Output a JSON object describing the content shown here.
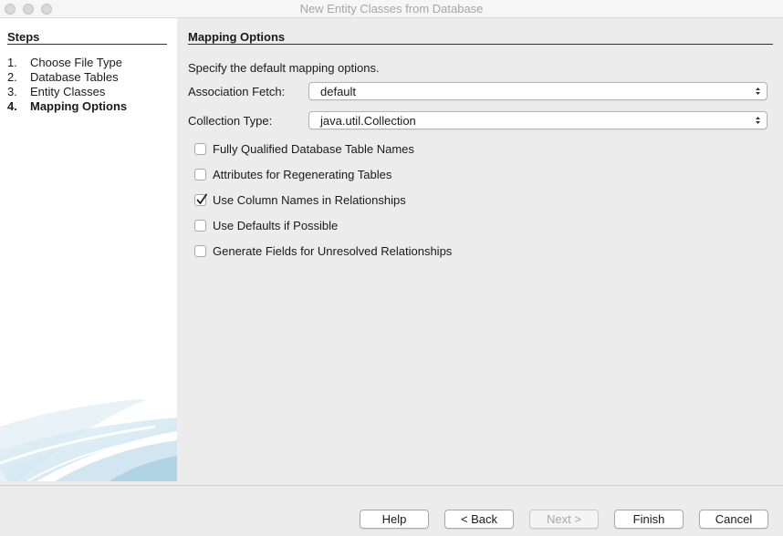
{
  "window": {
    "title": "New Entity Classes from Database"
  },
  "steps": {
    "header": "Steps",
    "items": [
      {
        "num": "1.",
        "label": "Choose File Type"
      },
      {
        "num": "2.",
        "label": "Database Tables"
      },
      {
        "num": "3.",
        "label": "Entity Classes"
      },
      {
        "num": "4.",
        "label": "Mapping Options"
      }
    ],
    "current_index": 3
  },
  "main": {
    "title": "Mapping Options",
    "description": "Specify the default mapping options.",
    "association_fetch": {
      "label": "Association Fetch:",
      "value": "default"
    },
    "collection_type": {
      "label": "Collection Type:",
      "value": "java.util.Collection"
    },
    "options": [
      {
        "label": "Fully Qualified Database Table Names",
        "checked": false
      },
      {
        "label": "Attributes for Regenerating Tables",
        "checked": false
      },
      {
        "label": "Use Column Names in Relationships",
        "checked": true
      },
      {
        "label": "Use Defaults if Possible",
        "checked": false
      },
      {
        "label": "Generate Fields for Unresolved Relationships",
        "checked": false
      }
    ]
  },
  "buttons": {
    "help": "Help",
    "back": "< Back",
    "next": "Next >",
    "finish": "Finish",
    "cancel": "Cancel"
  }
}
